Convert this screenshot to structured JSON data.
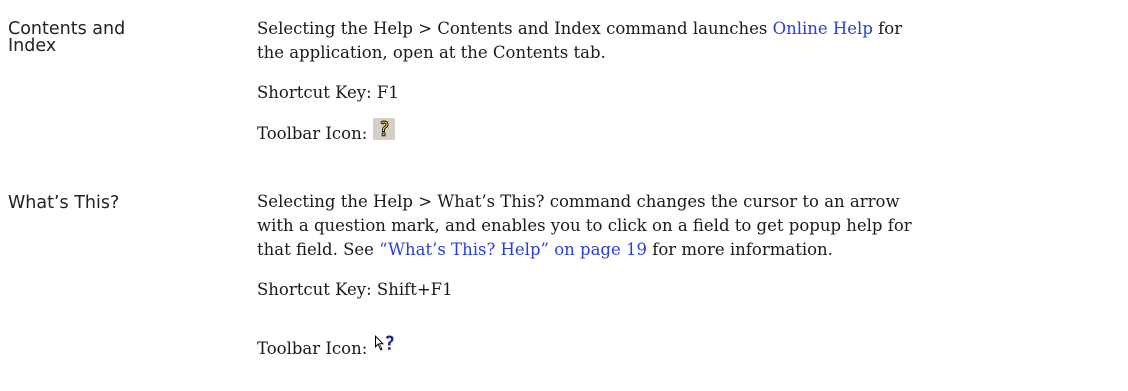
{
  "entries": [
    {
      "term": "Contents and\nIndex",
      "description": {
        "line1_pre": "Selecting the Help > Contents and Index command launches ",
        "line1_link": "Online Help",
        "line1_post": " for",
        "line2": "the application, open at the Contents tab."
      },
      "shortcut": "Shortcut Key: F1",
      "toolbar_label": "Toolbar Icon:",
      "toolbar_icon": "help-contents-icon"
    },
    {
      "term": "What’s This?",
      "description": {
        "line1": "Selecting the Help > What’s This? command changes the cursor to an arrow",
        "line2": "with a question mark, and enables you to click on a field to get popup help for",
        "line3_pre": "that field. See ",
        "line3_link": "“What’s This? Help” on page 19",
        "line3_post": " for more information."
      },
      "shortcut": "Shortcut Key: Shift+F1",
      "toolbar_label": "Toolbar Icon:",
      "toolbar_icon": "whats-this-icon"
    }
  ],
  "colors": {
    "link": "#2a3fd6",
    "text": "#1a1a1a",
    "icon_background": "#d4d0c8"
  }
}
